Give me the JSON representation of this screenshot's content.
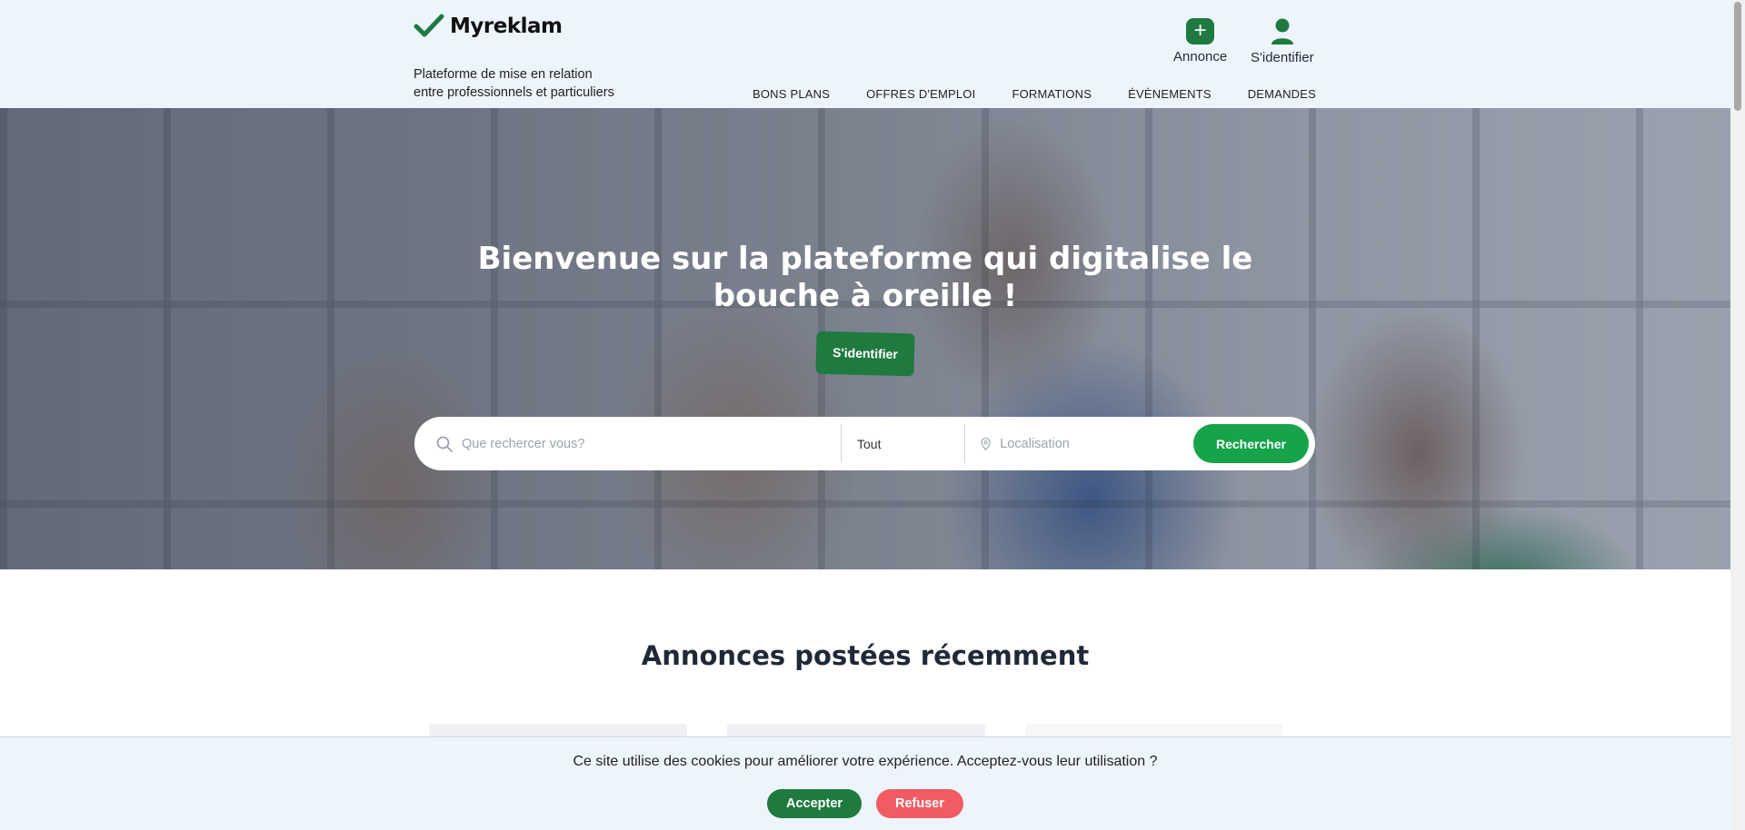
{
  "brand": {
    "name": "Myreklam",
    "accent": "#1e7a3f"
  },
  "header": {
    "tagline_line1": "Plateforme de mise en relation",
    "tagline_line2": "entre professionnels et particuliers",
    "annonce_label": "Annonce",
    "login_label": "S'identifier",
    "nav": [
      "BONS PLANS",
      "OFFRES D'EMPLOI",
      "FORMATIONS",
      "ÉVÈNEMENTS",
      "DEMANDES"
    ]
  },
  "hero": {
    "title_line1": "Bienvenue sur la plateforme qui digitalise le",
    "title_line2": "bouche à oreille !",
    "login_button": "S'identifier"
  },
  "search": {
    "query_placeholder": "Que rechercer vous?",
    "category_value": "Tout",
    "location_placeholder": "Localisation",
    "button_label": "Rechercher",
    "button_color": "#16a34a"
  },
  "recent": {
    "title": "Annonces postées récemment"
  },
  "cookie": {
    "message": "Ce site utilise des cookies pour améliorer votre expérience. Acceptez-vous leur utilisation ?",
    "accept_label": "Accepter",
    "refuse_label": "Refuser",
    "refuse_color": "#f15b62"
  }
}
